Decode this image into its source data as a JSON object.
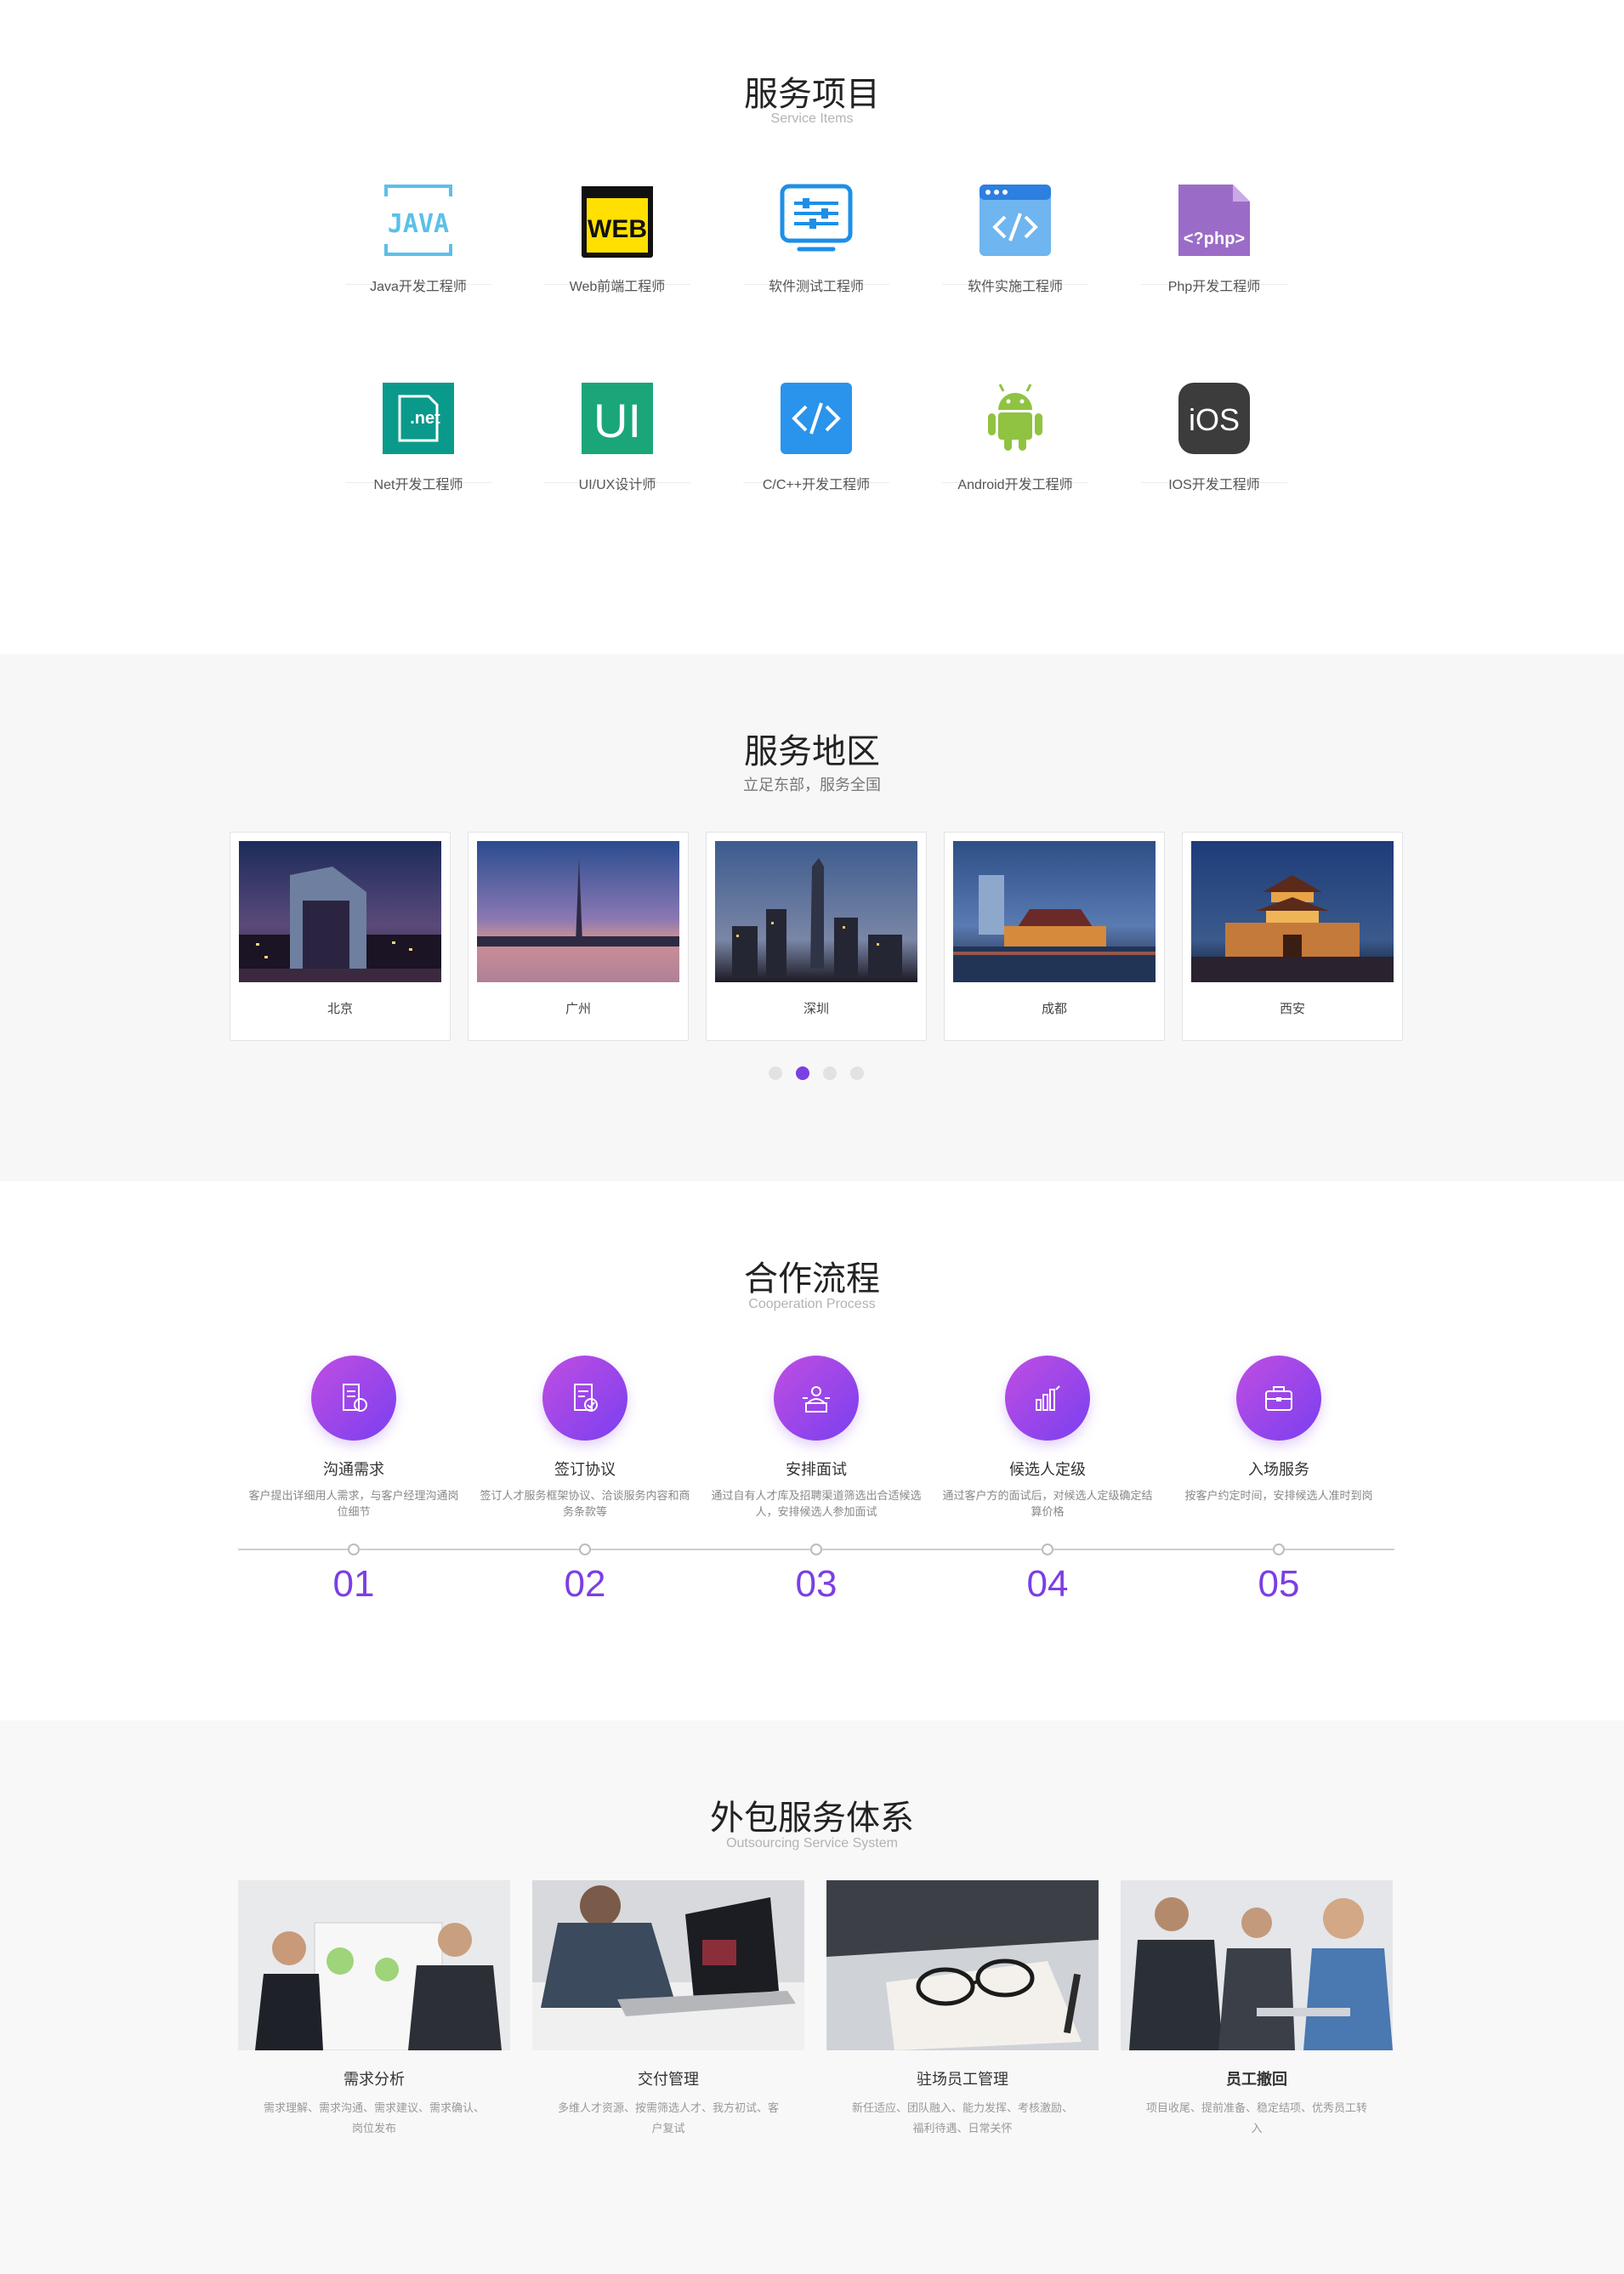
{
  "services": {
    "title": "服务项目",
    "subtitle": "Service Items",
    "items": [
      {
        "label": "Java开发工程师",
        "icon": "java-icon",
        "icon_text": "JAVA"
      },
      {
        "label": "Web前端工程师",
        "icon": "web-icon",
        "icon_text": "WEB"
      },
      {
        "label": "软件测试工程师",
        "icon": "sliders-icon"
      },
      {
        "label": "软件实施工程师",
        "icon": "browser-code-icon"
      },
      {
        "label": "Php开发工程师",
        "icon": "php-file-icon",
        "icon_text": "<?php>"
      },
      {
        "label": "Net开发工程师",
        "icon": "dotnet-icon",
        "icon_text": ".net"
      },
      {
        "label": "UI/UX设计师",
        "icon": "ui-icon",
        "icon_text": "UI"
      },
      {
        "label": "C/C++开发工程师",
        "icon": "code-icon"
      },
      {
        "label": "Android开发工程师",
        "icon": "android-icon"
      },
      {
        "label": "IOS开发工程师",
        "icon": "ios-icon",
        "icon_text": "iOS"
      }
    ]
  },
  "regions": {
    "title": "服务地区",
    "subtitle": "立足东部，服务全国",
    "cities": [
      {
        "name": "北京"
      },
      {
        "name": "广州"
      },
      {
        "name": "深圳"
      },
      {
        "name": "成都"
      },
      {
        "name": "西安"
      }
    ],
    "pager": {
      "count": 4,
      "active_index": 1
    }
  },
  "process": {
    "title": "合作流程",
    "subtitle": "Cooperation Process",
    "steps": [
      {
        "name": "沟通需求",
        "desc": "客户提出详细用人需求，与客户经理沟通岗位细节",
        "num": "01",
        "icon": "document-chat-icon"
      },
      {
        "name": "签订协议",
        "desc": "签订人才服务框架协议、洽谈服务内容和商务条款等",
        "num": "02",
        "icon": "contract-check-icon"
      },
      {
        "name": "安排面试",
        "desc": "通过自有人才库及招聘渠道筛选出合适候选人，安排候选人参加面试",
        "num": "03",
        "icon": "interview-icon"
      },
      {
        "name": "候选人定级",
        "desc": "通过客户方的面试后，对候选人定级确定结算价格",
        "num": "04",
        "icon": "bar-chart-icon"
      },
      {
        "name": "入场服务",
        "desc": "按客户约定时间，安排候选人准时到岗",
        "num": "05",
        "icon": "briefcase-icon"
      }
    ]
  },
  "outsourcing": {
    "title": "外包服务体系",
    "subtitle": "Outsourcing Service System",
    "cards": [
      {
        "title": "需求分析",
        "desc": "需求理解、需求沟通、需求建议、需求确认、岗位发布"
      },
      {
        "title": "交付管理",
        "desc": "多维人才资源、按需筛选人才、我方初试、客户复试"
      },
      {
        "title": "驻场员工管理",
        "desc": "新任适应、团队融入、能力发挥、考核激励、福利待遇、日常关怀"
      },
      {
        "title": "员工撤回",
        "desc": "项目收尾、提前准备、稳定结项、优秀员工转入"
      }
    ]
  },
  "colors": {
    "accent": "#7b3fe4",
    "gradient_start": "#c04ee2",
    "gradient_end": "#7a3ff0"
  }
}
